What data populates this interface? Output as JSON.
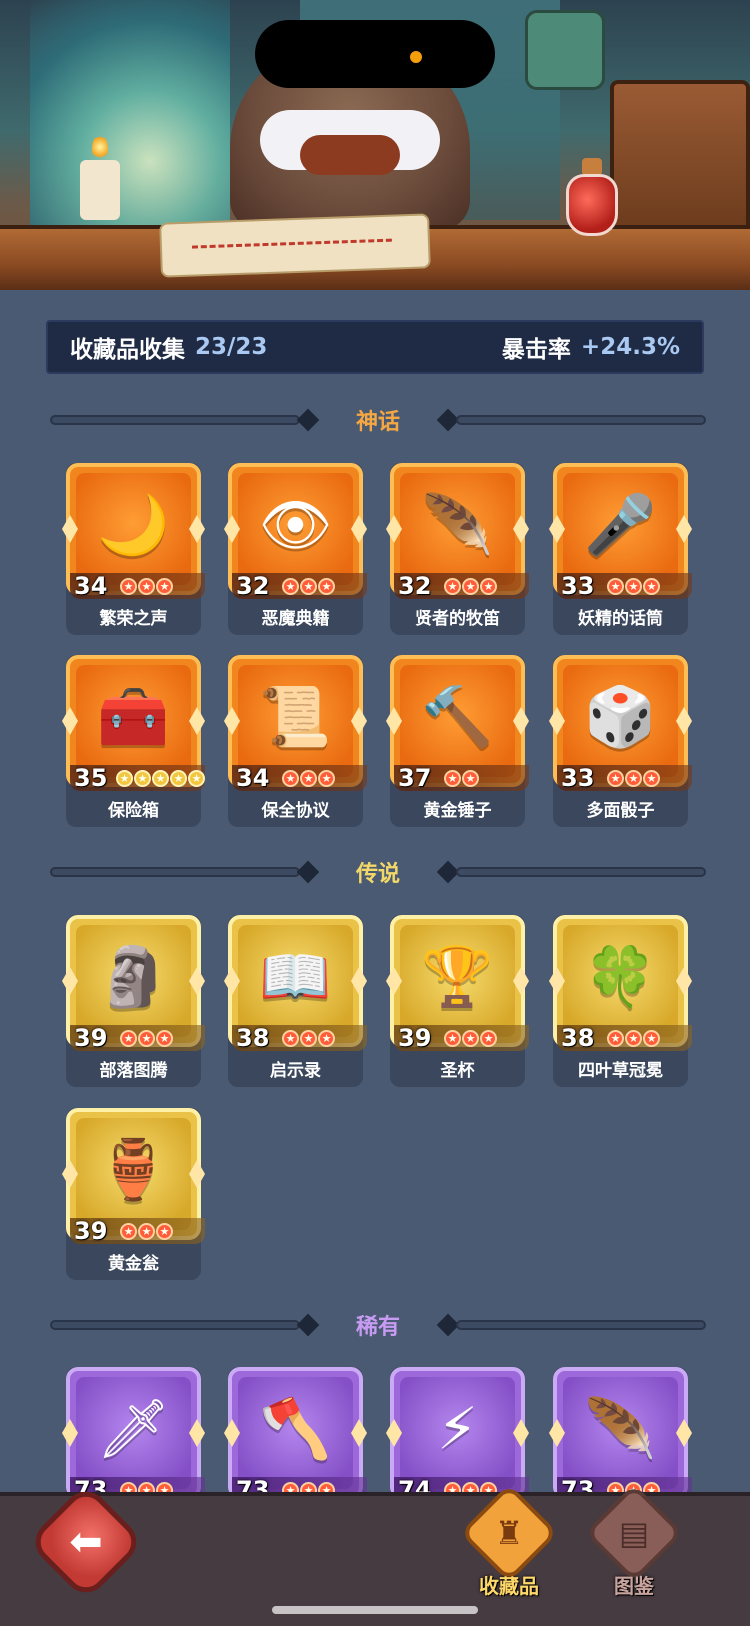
{
  "summary": {
    "collection_label": "收藏品收集",
    "collection_value": "23/23",
    "crit_label": "暴击率",
    "crit_value": "+24.3%"
  },
  "sections": {
    "mythic": {
      "title": "神话",
      "color": "#f4a742"
    },
    "legendary": {
      "title": "传说",
      "color": "#f2d868"
    },
    "rare": {
      "title": "稀有",
      "color": "#c89bf3"
    }
  },
  "mythic_items": [
    {
      "name": "繁荣之声",
      "level": "34",
      "stars": 3,
      "icon": "moon-orb-icon",
      "glyph": "🌙"
    },
    {
      "name": "恶魔典籍",
      "level": "32",
      "stars": 3,
      "icon": "demon-tome-icon",
      "glyph": "👁"
    },
    {
      "name": "贤者的牧笛",
      "level": "32",
      "stars": 3,
      "icon": "flute-icon",
      "glyph": "🪶"
    },
    {
      "name": "妖精的话筒",
      "level": "33",
      "stars": 3,
      "icon": "fairy-mic-icon",
      "glyph": "🎤"
    },
    {
      "name": "保险箱",
      "level": "35",
      "stars": 5,
      "icon": "treasure-chest-icon",
      "glyph": "🧰"
    },
    {
      "name": "保全协议",
      "level": "34",
      "stars": 3,
      "icon": "contract-icon",
      "glyph": "📜"
    },
    {
      "name": "黄金锤子",
      "level": "37",
      "stars": 2,
      "icon": "hammer-icon",
      "glyph": "🔨"
    },
    {
      "name": "多面骰子",
      "level": "33",
      "stars": 3,
      "icon": "dice-icon",
      "glyph": "🎲"
    }
  ],
  "legendary_items": [
    {
      "name": "部落图腾",
      "level": "39",
      "stars": 3,
      "icon": "totem-icon",
      "glyph": "🗿"
    },
    {
      "name": "启示录",
      "level": "38",
      "stars": 3,
      "icon": "book-icon",
      "glyph": "📖"
    },
    {
      "name": "圣杯",
      "level": "39",
      "stars": 3,
      "icon": "grail-icon",
      "glyph": "🏆"
    },
    {
      "name": "四叶草冠冕",
      "level": "38",
      "stars": 3,
      "icon": "clover-crown-icon",
      "glyph": "🍀"
    },
    {
      "name": "黄金瓮",
      "level": "39",
      "stars": 3,
      "icon": "golden-urn-icon",
      "glyph": "🏺"
    }
  ],
  "rare_items": [
    {
      "name": "",
      "level": "73",
      "stars": 3,
      "icon": "ice-sword-icon",
      "glyph": "🗡"
    },
    {
      "name": "",
      "level": "73",
      "stars": 3,
      "icon": "axe-icon",
      "glyph": "🪓"
    },
    {
      "name": "",
      "level": "74",
      "stars": 3,
      "icon": "lightning-scroll-icon",
      "glyph": "⚡"
    },
    {
      "name": "",
      "level": "73",
      "stars": 3,
      "icon": "phoenix-feather-icon",
      "glyph": "🪶"
    }
  ],
  "nav": {
    "back_icon": "back-arrow-icon",
    "collection_label": "收藏品",
    "codex_label": "图鉴"
  }
}
